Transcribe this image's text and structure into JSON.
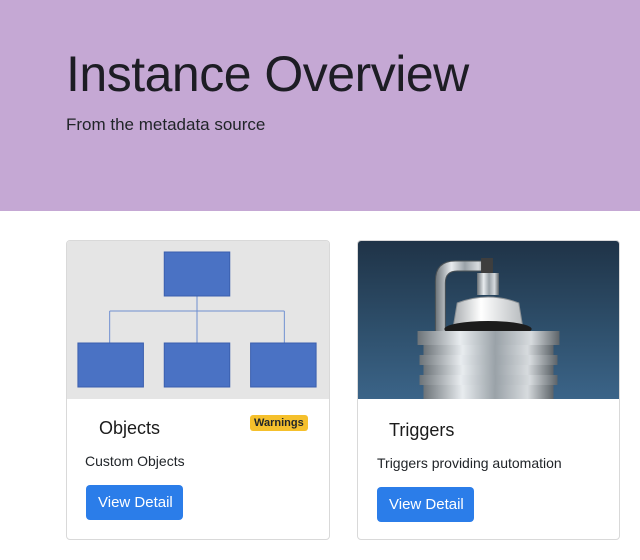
{
  "header": {
    "title": "Instance Overview",
    "subtitle": "From the metadata source",
    "background_color": "#c5a8d4"
  },
  "cards": [
    {
      "title": "Objects",
      "badge": "Warnings",
      "badge_color": "#f5c02c",
      "description": "Custom Objects",
      "button_label": "View Detail",
      "image_icon": "org-chart-icon"
    },
    {
      "title": "Triggers",
      "description": "Triggers providing automation",
      "button_label": "View Detail",
      "image_icon": "spark-plug-icon"
    }
  ],
  "button_color": "#2b7de9"
}
